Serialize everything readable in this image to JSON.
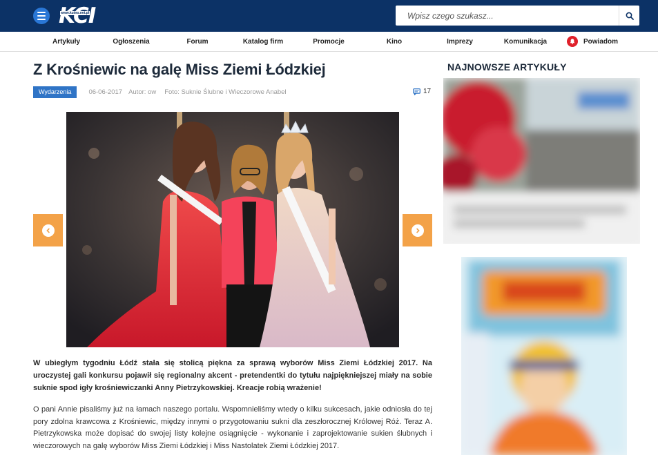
{
  "header": {
    "logo_text": "KCI",
    "logo_sub": "www.kutno.net.pl",
    "search_placeholder": "Wpisz czego szukasz...",
    "brand_color": "#0c3266"
  },
  "nav": {
    "items": [
      {
        "label": "Artykuły"
      },
      {
        "label": "Ogłoszenia"
      },
      {
        "label": "Forum"
      },
      {
        "label": "Katalog firm"
      },
      {
        "label": "Promocje"
      },
      {
        "label": "Kino"
      },
      {
        "label": "Imprezy"
      },
      {
        "label": "Komunikacja"
      }
    ],
    "notify_label": "Powiadom"
  },
  "article": {
    "title": "Z Krośniewic na galę Miss Ziemi Łódzkiej",
    "category": "Wydarzenia",
    "date": "06-06-2017",
    "author": "Autor: ow",
    "photo_credit": "Foto: Suknie Ślubne i Wieczorowe Anabel",
    "comment_count": "17",
    "lead": "W ubiegłym tygodniu Łódź stała się stolicą piękna za sprawą wyborów Miss Ziemi Łódzkiej 2017. Na uroczystej gali konkursu pojawił się regionalny akcent - pretendentki do tytułu najpiękniejszej miały na sobie suknie spod igły krośniewiczanki Anny Pietrzykowskiej. Kreacje robią wrażenie!",
    "paragraph": "O pani Annie pisaliśmy już na łamach naszego portalu. Wspomnieliśmy wtedy o kilku sukcesach, jakie odniosła do tej pory zdolna krawcowa z Krośniewic, między innymi o przygotowaniu sukni dla zeszłorocznej Królowej Róż. Teraz A. Pietrzykowska może dopisać do swojej listy kolejne osiągnięcie - wykonanie i zaprojektowanie sukien ślubnych i wieczorowych na galę wyborów Miss Ziemi Łódzkiej i Miss Nastolatek Ziemi Łódzkiej 2017."
  },
  "sidebar": {
    "title": "NAJNOWSZE ARTYKUŁY"
  },
  "colors": {
    "tag": "#2f74c6",
    "arrow": "#f3a248",
    "bell": "#e0202a"
  }
}
